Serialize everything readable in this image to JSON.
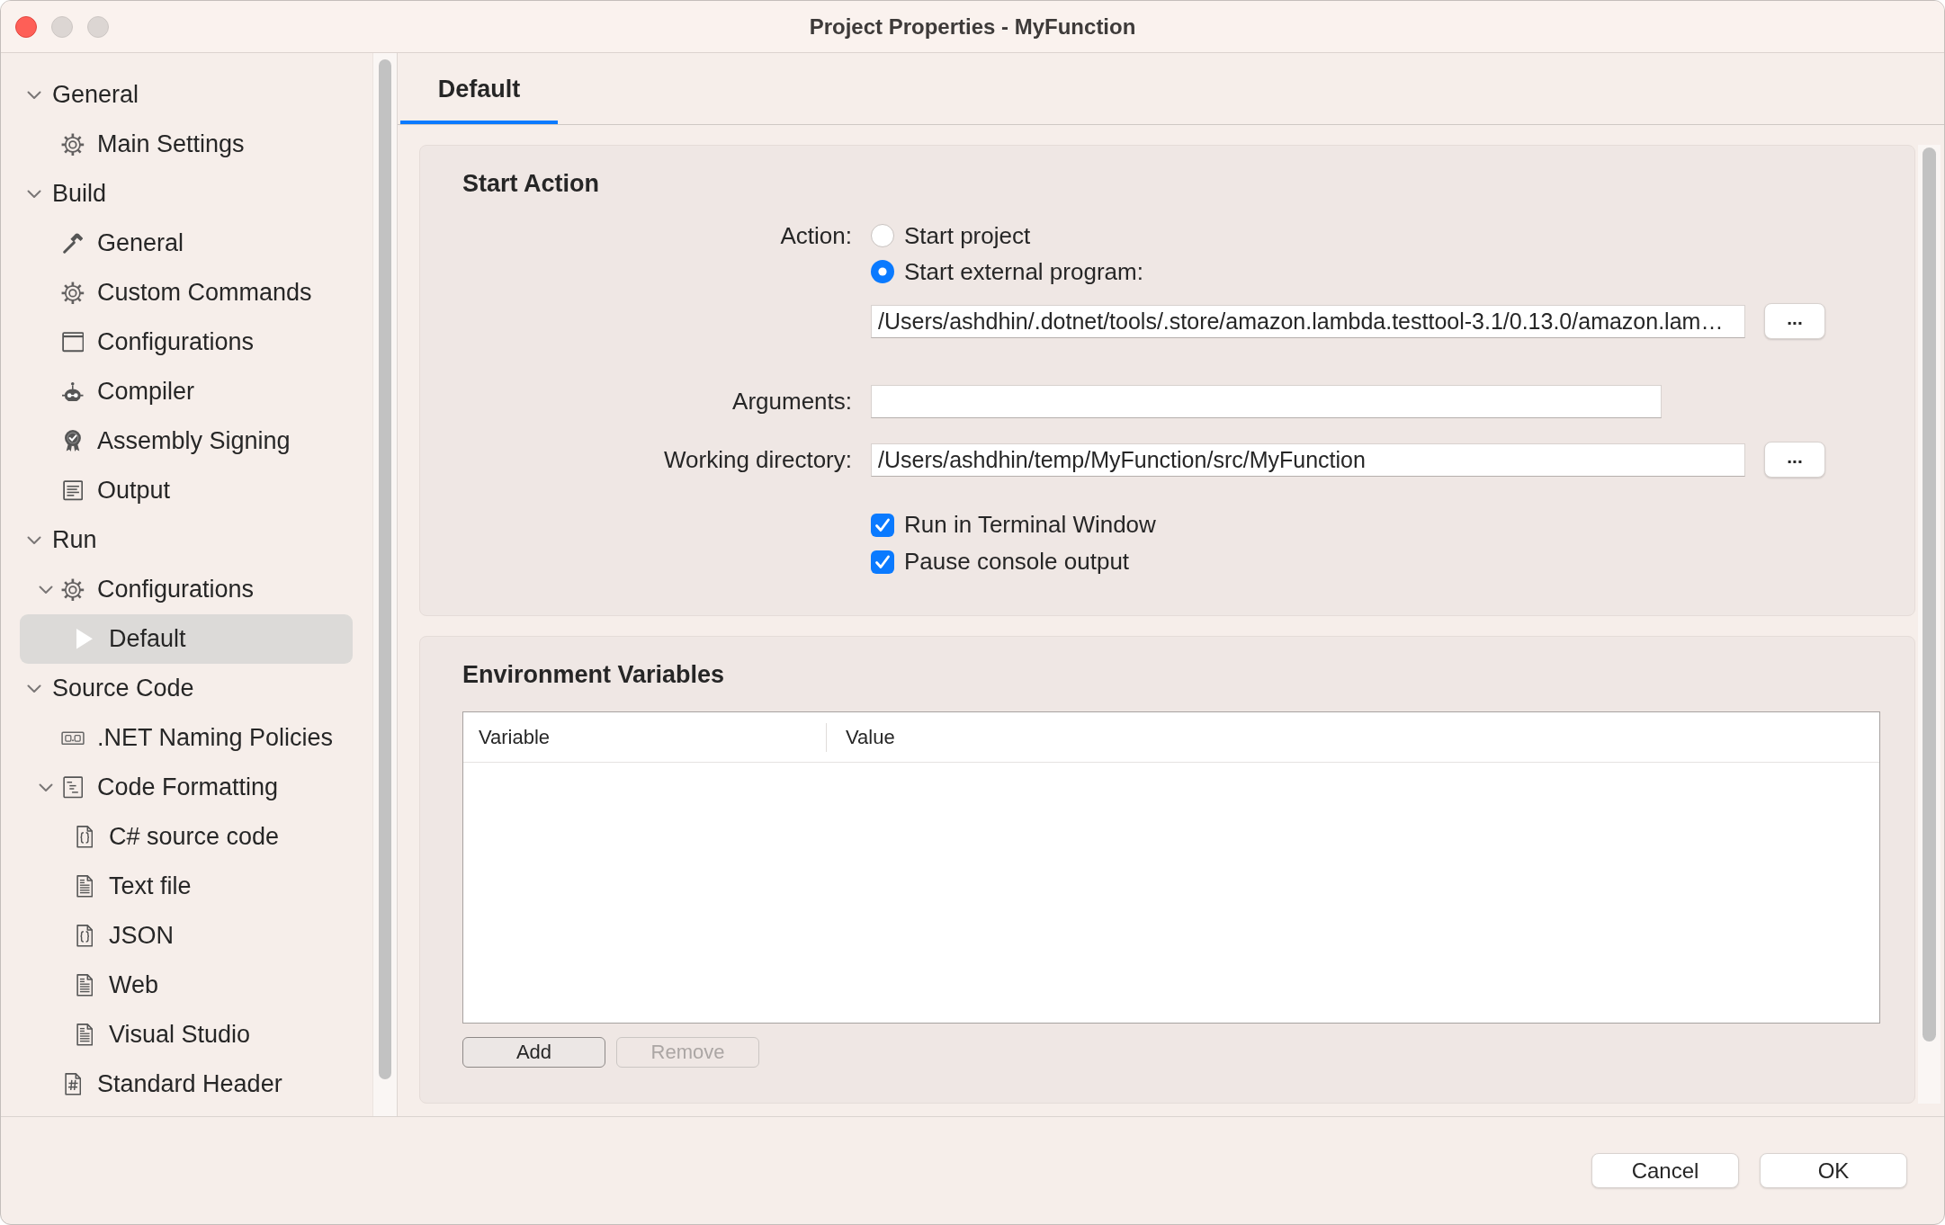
{
  "window": {
    "title": "Project Properties - MyFunction"
  },
  "sidebar": {
    "items": [
      {
        "label": "General",
        "expanded": true,
        "selected": false,
        "children": [
          {
            "label": "Main Settings",
            "selected": false
          }
        ]
      },
      {
        "label": "Build",
        "expanded": true,
        "selected": false,
        "children": [
          {
            "label": "General",
            "selected": false
          },
          {
            "label": "Custom Commands",
            "selected": false
          },
          {
            "label": "Configurations",
            "selected": false
          },
          {
            "label": "Compiler",
            "selected": false
          },
          {
            "label": "Assembly Signing",
            "selected": false
          },
          {
            "label": "Output",
            "selected": false
          }
        ]
      },
      {
        "label": "Run",
        "expanded": true,
        "selected": false,
        "children": [
          {
            "label": "Configurations",
            "expanded": true,
            "selected": false,
            "children": [
              {
                "label": "Default",
                "selected": true
              }
            ]
          }
        ]
      },
      {
        "label": "Source Code",
        "expanded": true,
        "selected": false,
        "children": [
          {
            "label": ".NET Naming Policies",
            "selected": false
          },
          {
            "label": "Code Formatting",
            "expanded": true,
            "selected": false,
            "children": [
              {
                "label": "C# source code",
                "selected": false
              },
              {
                "label": "Text file",
                "selected": false
              },
              {
                "label": "JSON",
                "selected": false
              },
              {
                "label": "Web",
                "selected": false
              },
              {
                "label": "Visual Studio",
                "selected": false
              }
            ]
          },
          {
            "label": "Standard Header",
            "selected": false
          }
        ]
      }
    ]
  },
  "tabs": [
    {
      "label": "Default",
      "selected": true
    }
  ],
  "start_action": {
    "title": "Start Action",
    "action_label": "Action:",
    "options": [
      {
        "label": "Start project",
        "selected": false
      },
      {
        "label": "Start external program:",
        "selected": true
      }
    ],
    "program_path": {
      "value": "/Users/ashdhin/.dotnet/tools/.store/amazon.lambda.testtool-3.1/0.13.0/amazon.lam…",
      "browse_button": "..."
    },
    "arguments": {
      "label": "Arguments:"
    },
    "working_directory": {
      "label": "Working directory:",
      "value": "/Users/ashdhin/temp/MyFunction/src/MyFunction",
      "browse_button": "..."
    },
    "checkboxes": [
      {
        "label": "Run in Terminal Window",
        "checked": true
      },
      {
        "label": "Pause console output",
        "checked": true
      }
    ]
  },
  "environment_variables": {
    "title": "Environment Variables",
    "table": {
      "columns": [
        "Variable",
        "Value"
      ]
    },
    "buttons": [
      {
        "label": "Add",
        "disabled": false
      },
      {
        "label": "Remove",
        "disabled": true
      }
    ]
  },
  "dialog_buttons": [
    "Cancel",
    "OK"
  ]
}
